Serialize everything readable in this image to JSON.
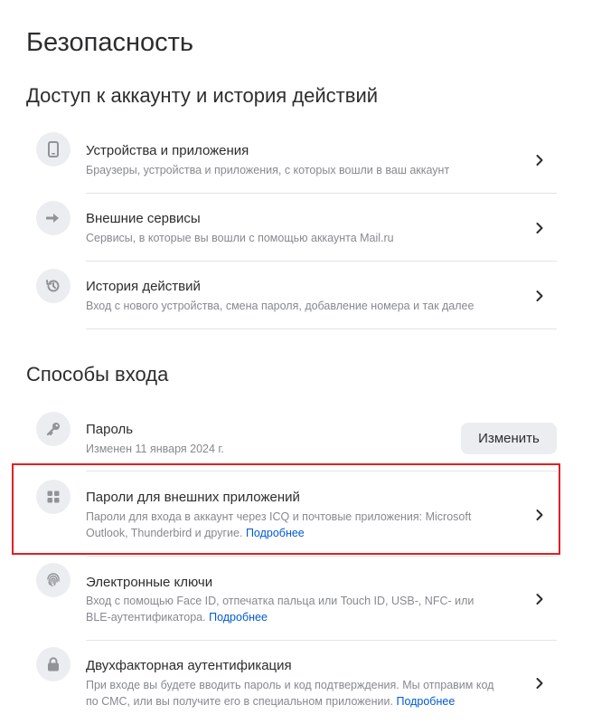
{
  "page_title": "Безопасность",
  "sections": {
    "access": {
      "title": "Доступ к аккаунту и история действий",
      "items": [
        {
          "title": "Устройства и приложения",
          "desc": "Браузеры, устройства и приложения, с которых вошли в ваш аккаунт",
          "icon": "phone-icon"
        },
        {
          "title": "Внешние сервисы",
          "desc": "Сервисы, в которые вы вошли с помощью аккаунта Mail.ru",
          "icon": "arrow-right-icon"
        },
        {
          "title": "История действий",
          "desc": "Вход с нового устройства, смена пароля, добавление номера и так далее",
          "icon": "history-icon"
        }
      ]
    },
    "login": {
      "title": "Способы входа",
      "password": {
        "title": "Пароль",
        "desc": "Изменен 11 января 2024 г.",
        "button": "Изменить",
        "icon": "key-icon"
      },
      "items": [
        {
          "title": "Пароли для внешних приложений",
          "desc": "Пароли для входа в аккаунт через ICQ и почтовые приложения: Microsoft Outlook, Thunderbird и другие.",
          "more": "Подробнее",
          "icon": "apps-grid-icon"
        },
        {
          "title": "Электронные ключи",
          "desc": "Вход с помощью Face ID, отпечатка пальца или Touch ID, USB-, NFC- или BLE-аутентификатора.",
          "more": "Подробнее",
          "icon": "fingerprint-icon"
        },
        {
          "title": "Двухфакторная аутентификация",
          "desc": "При входе вы будете вводить пароль и код подтверждения. Мы отправим код по СМС, или вы получите его в специальном приложении.",
          "more": "Подробнее",
          "icon": "lock-icon"
        }
      ]
    }
  },
  "colors": {
    "text": "#2c2d2e",
    "secondary": "#87898f",
    "link": "#005bd1",
    "icon_bg": "#ecedf0",
    "highlight": "#e31e24"
  }
}
